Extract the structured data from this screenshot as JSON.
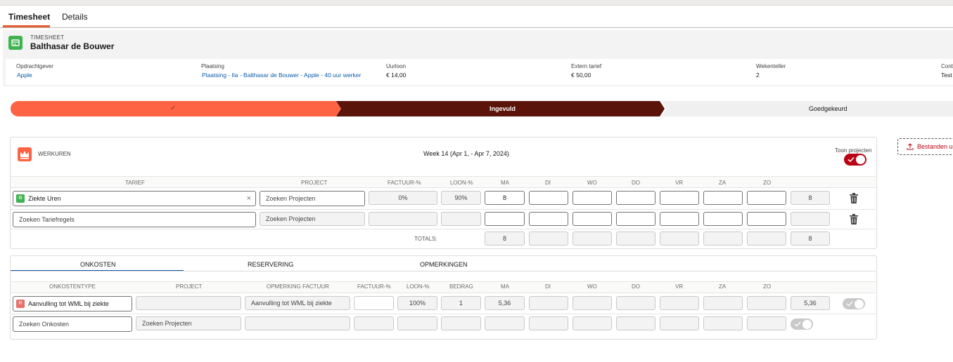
{
  "tabs": [
    {
      "label": "Timesheet"
    },
    {
      "label": "Details"
    }
  ],
  "header": {
    "object_type": "TIMESHEET",
    "title": "Balthasar de Bouwer",
    "fields": [
      {
        "label": "Opdrachtgever",
        "value": "Apple"
      },
      {
        "label": "Plaatsing",
        "value": "Plaatsing - Ila - Balthasar de Bouwer - Apple - 40 uur werker"
      },
      {
        "label": "Uurloon",
        "value": "€ 14,00"
      },
      {
        "label": "Extern tarief",
        "value": "€ 50,00"
      },
      {
        "label": "Wekenteller",
        "value": "2"
      },
      {
        "label": "Cont",
        "value": "Test"
      }
    ]
  },
  "path": {
    "steps": [
      {
        "label": "✓"
      },
      {
        "label": "Ingevuld"
      },
      {
        "label": "Goedgekeurd"
      }
    ]
  },
  "werkuren": {
    "title": "WERKUREN",
    "week": "Week 14 (Apr 1, - Apr 7, 2024)",
    "toggle_label": "Toon projecten",
    "columns": [
      "TARIEF",
      "PROJECT",
      "FACTUUR-%",
      "LOON-%",
      "MA",
      "DI",
      "WO",
      "DO",
      "VR",
      "ZA",
      "ZO"
    ],
    "rows": [
      {
        "tarief": "Ziekte Uren",
        "project_placeholder": "Zoeken Projecten",
        "factuur": "0%",
        "loon": "90%",
        "days": [
          "8",
          "",
          "",
          "",
          "",
          "",
          ""
        ],
        "total": "8"
      },
      {
        "tarief_placeholder": "Zoeken Tariefregels",
        "project_placeholder": "Zoeken Projecten",
        "factuur": "",
        "loon": "",
        "days": [
          "",
          "",
          "",
          "",
          "",
          "",
          ""
        ],
        "total": ""
      }
    ],
    "totals_label": "TOTALS:",
    "totals": [
      "8",
      "",
      "",
      "",
      "",
      "",
      ""
    ],
    "grand_total": "8"
  },
  "upload_button": "Bestanden up",
  "subtabs": [
    {
      "label": "ONKOSTEN"
    },
    {
      "label": "RESERVERING"
    },
    {
      "label": "OPMERKINGEN"
    }
  ],
  "onkosten": {
    "columns": [
      "ONKOSTENTYPE",
      "PROJECT",
      "OPMERKING FACTUUR",
      "FACTUUR-%",
      "LOON-%",
      "BEDRAG",
      "MA",
      "DI",
      "WO",
      "DO",
      "VR",
      "ZA",
      "ZO"
    ],
    "rows": [
      {
        "type": "Aanvulling tot WML bij ziekte",
        "project": "",
        "opmerking": "Aanvulling tot WML bij ziekte",
        "factuur": "",
        "loon": "100%",
        "bedrag": "1",
        "days": [
          "5,36",
          "",
          "",
          "",
          "",
          "",
          ""
        ],
        "total": "5,36"
      },
      {
        "type_placeholder": "Zoeken Onkosten",
        "project_placeholder": "Zoeken Projecten",
        "opmerking": "",
        "factuur": "",
        "loon": "",
        "bedrag": "",
        "days": [
          "",
          "",
          "",
          "",
          "",
          "",
          ""
        ],
        "total": ""
      }
    ]
  },
  "colors": {
    "accent": "#e35a2d",
    "path_done": "#fe6343",
    "path_current": "#5a1409",
    "toggle": "#ba0517",
    "link": "#0b5cab"
  }
}
